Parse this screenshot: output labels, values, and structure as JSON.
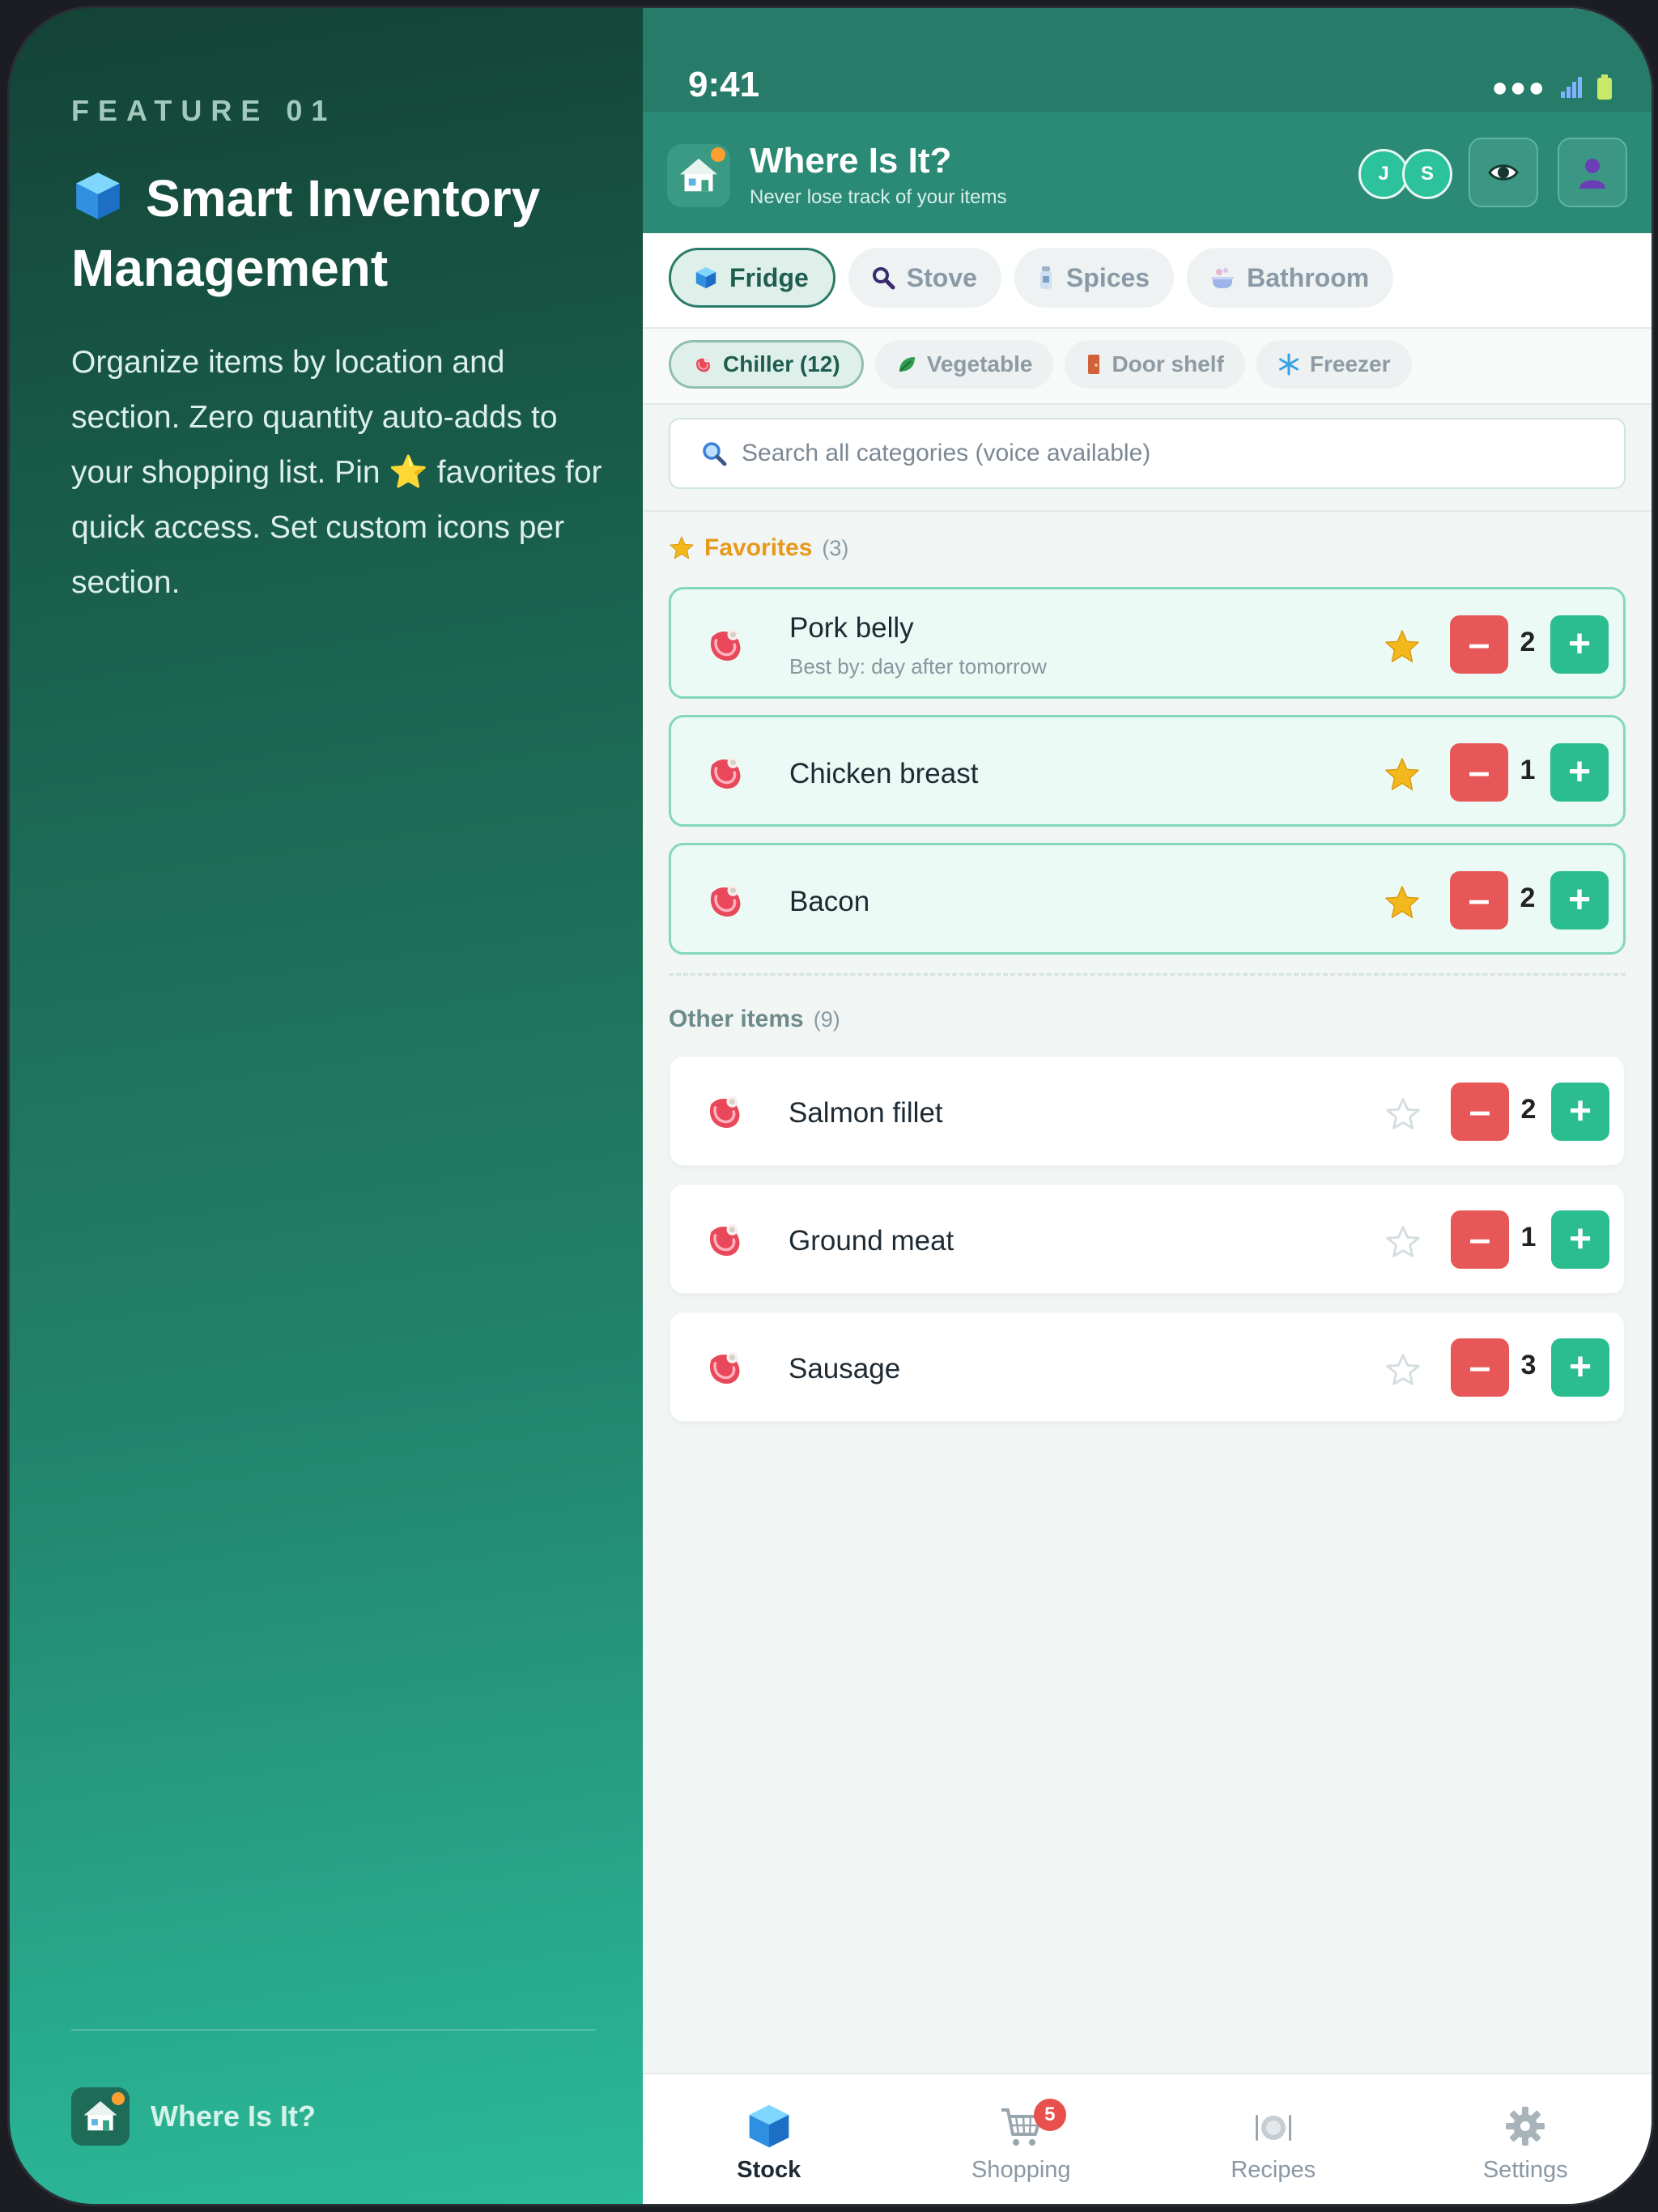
{
  "feature": {
    "kicker": "FEATURE 01",
    "title": "Smart Inventory Management",
    "description": "Organize items by location and section. Zero quantity auto-adds to your shopping list. Pin ⭐ favorites for quick access. Set custom icons per section.",
    "brand_name": "Where Is It?"
  },
  "status_bar": {
    "time": "9:41",
    "icons": [
      "signal-dots",
      "wifi",
      "battery"
    ]
  },
  "header": {
    "app_name": "Where Is It?",
    "tagline": "Never lose track of your items",
    "avatars": [
      "J",
      "S"
    ],
    "buttons": [
      "eye-icon",
      "user-icon"
    ]
  },
  "locations": [
    {
      "label": "Fridge",
      "icon": "cube-icon",
      "active": true
    },
    {
      "label": "Stove",
      "icon": "magnifier-icon",
      "active": false
    },
    {
      "label": "Spices",
      "icon": "spice-bottle-icon",
      "active": false
    },
    {
      "label": "Bathroom",
      "icon": "bathtub-icon",
      "active": false
    }
  ],
  "sections": [
    {
      "label": "Chiller (12)",
      "icon": "meat-icon",
      "active": true
    },
    {
      "label": "Vegetable",
      "icon": "leaf-icon",
      "active": false
    },
    {
      "label": "Door shelf",
      "icon": "door-icon",
      "active": false
    },
    {
      "label": "Freezer",
      "icon": "snowflake-icon",
      "active": false
    }
  ],
  "search": {
    "placeholder": "Search all categories (voice available)"
  },
  "favorites": {
    "title": "Favorites",
    "count": "(3)",
    "items": [
      {
        "name": "Pork belly",
        "sub": "Best by: day after tomorrow",
        "qty": "2"
      },
      {
        "name": "Chicken breast",
        "sub": "",
        "qty": "1"
      },
      {
        "name": "Bacon",
        "sub": "",
        "qty": "2"
      }
    ]
  },
  "other": {
    "title": "Other items",
    "count": "(9)",
    "items": [
      {
        "name": "Salmon fillet",
        "qty": "2"
      },
      {
        "name": "Ground meat",
        "qty": "1"
      },
      {
        "name": "Sausage",
        "qty": "3"
      }
    ]
  },
  "controls": {
    "minus": "–",
    "plus": "+"
  },
  "bottom_nav": [
    {
      "label": "Stock",
      "icon": "cube-icon",
      "active": true
    },
    {
      "label": "Shopping",
      "icon": "cart-icon",
      "badge": "5"
    },
    {
      "label": "Recipes",
      "icon": "plate-icon"
    },
    {
      "label": "Settings",
      "icon": "gear-icon"
    }
  ],
  "colors": {
    "brand_dark": "#134336",
    "brand": "#2a8a75",
    "accent_green": "#2bbd8f",
    "danger": "#e85757",
    "favorite": "#e79a1a"
  }
}
